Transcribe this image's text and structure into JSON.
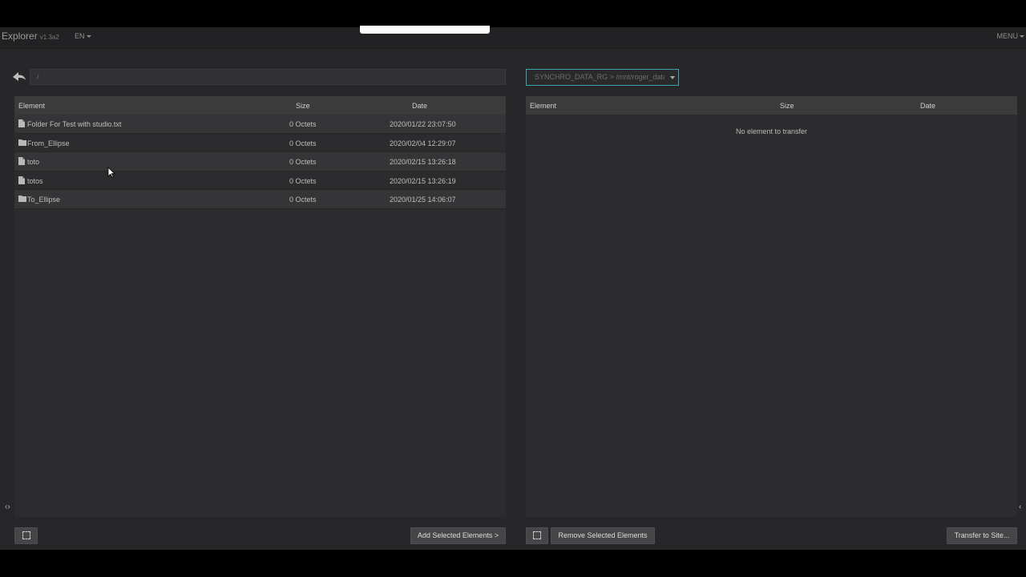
{
  "topbar": {
    "app_name": "Explorer",
    "version": "v1.3a2",
    "language": "EN",
    "menu_label": "MENU"
  },
  "source": {
    "path_value": "/",
    "columns": {
      "element": "Element",
      "size": "Size",
      "date": "Date"
    },
    "rows": [
      {
        "type": "file",
        "name": "Folder For Test with studio.txt",
        "size": "0 Octets",
        "date": "2020/01/22 23:07:50"
      },
      {
        "type": "folder",
        "name": "From_Ellipse",
        "size": "0 Octets",
        "date": "2020/02/04 12:29:07"
      },
      {
        "type": "file",
        "name": "toto",
        "size": "0 Octets",
        "date": "2020/02/15 13:26:18"
      },
      {
        "type": "file",
        "name": "totos",
        "size": "0 Octets",
        "date": "2020/02/15 13:26:19"
      },
      {
        "type": "folder",
        "name": "To_Ellipse",
        "size": "0 Octets",
        "date": "2020/01/25 14:06:07"
      }
    ],
    "add_button": "Add Selected Elements >"
  },
  "destination": {
    "site_selected": "SYNCHRO_DATA_RG > /mnt/roger_data",
    "columns": {
      "element": "Element",
      "size": "Size",
      "date": "Date"
    },
    "empty_message": "No element to transfer",
    "remove_button": "Remove Selected Elements",
    "transfer_button": "Transfer to Site..."
  },
  "colors": {
    "background": "#272729",
    "header_row": "#3b3b3c",
    "accent_border": "#3fa0b4",
    "button": "#464648"
  },
  "icons": {
    "back": "arrow-left-icon",
    "file": "file-icon",
    "folder": "folder-icon",
    "select_all": "dashed-square-icon",
    "panel_toggle": "chevron-icon",
    "cursor": "mouse-cursor-icon"
  }
}
